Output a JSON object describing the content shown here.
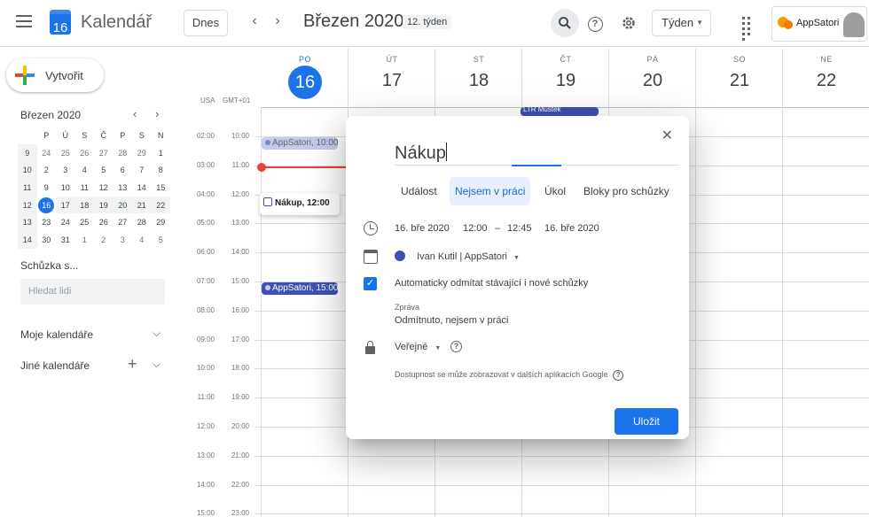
{
  "header": {
    "app_name": "Kalendář",
    "logo_day": "16",
    "today_label": "Dnes",
    "prev_icon": "chevron-left-icon",
    "next_icon": "chevron-right-icon",
    "current_month": "Březen 2020",
    "week_badge": "12. týden",
    "view_selector": "Týden",
    "brand_name": "AppSatori"
  },
  "sidebar": {
    "create_label": "Vytvořit",
    "mini_month": "Březen 2020",
    "weekday_headers": [
      "P",
      "Ú",
      "S",
      "Č",
      "P",
      "S",
      "N"
    ],
    "weeks": [
      {
        "wk": "9",
        "days": [
          "24",
          "25",
          "26",
          "27",
          "28",
          "29",
          "1"
        ]
      },
      {
        "wk": "10",
        "days": [
          "2",
          "3",
          "4",
          "5",
          "6",
          "7",
          "8"
        ]
      },
      {
        "wk": "11",
        "days": [
          "9",
          "10",
          "11",
          "12",
          "13",
          "14",
          "15"
        ]
      },
      {
        "wk": "12",
        "days": [
          "16",
          "17",
          "18",
          "19",
          "20",
          "21",
          "22"
        ]
      },
      {
        "wk": "13",
        "days": [
          "23",
          "24",
          "25",
          "26",
          "27",
          "28",
          "29"
        ]
      },
      {
        "wk": "14",
        "days": [
          "30",
          "31",
          "1",
          "2",
          "3",
          "4",
          "5"
        ]
      }
    ],
    "meeting_with": "Schůzka s...",
    "people_placeholder": "Hledat lidi",
    "my_calendars": "Moje kalendáře",
    "other_calendars": "Jiné kalendáře"
  },
  "week": {
    "tz_left": "USA",
    "tz_right": "GMT+01",
    "days": [
      {
        "name": "PO",
        "date": "16"
      },
      {
        "name": "ÚT",
        "date": "17"
      },
      {
        "name": "ST",
        "date": "18"
      },
      {
        "name": "ČT",
        "date": "19"
      },
      {
        "name": "PÁ",
        "date": "20"
      },
      {
        "name": "SO",
        "date": "21"
      },
      {
        "name": "NE",
        "date": "22"
      }
    ],
    "times_usa": [
      "02:00",
      "03:00",
      "04:00",
      "05:00",
      "06:00",
      "07:00",
      "08:00",
      "09:00",
      "10:00",
      "11:00",
      "12:00",
      "13:00",
      "14:00",
      "15:00"
    ],
    "times_local": [
      "10:00",
      "11:00",
      "12:00",
      "13:00",
      "14:00",
      "15:00",
      "16:00",
      "17:00",
      "18:00",
      "19:00",
      "20:00",
      "21:00",
      "22:00",
      "23:00"
    ],
    "events": [
      {
        "title": "AppSatori, 10:00"
      },
      {
        "title": "Nákup, 12:00"
      },
      {
        "title": "AppSatori, 15:00"
      },
      {
        "title": "LTR Mustek"
      }
    ]
  },
  "dialog": {
    "title_value": "Nákup",
    "tabs": [
      "Událost",
      "Nejsem v práci",
      "Úkol",
      "Bloky pro schůzky"
    ],
    "start_date": "16. bře 2020",
    "start_time": "12:00",
    "dash": "–",
    "end_time": "12:45",
    "end_date": "16. bře 2020",
    "calendar_owner": "Ivan Kutil | AppSatori",
    "auto_decline": "Automaticky odmítat stávající i nové schůzky",
    "message_label": "Zpráva",
    "message_value": "Odmítnuto, nejsem v práci",
    "visibility": "Veřejné",
    "availability_note": "Dostupnost se může zobrazovat v dalších aplikacích Google",
    "save_label": "Uložit"
  },
  "colors": {
    "accent": "#1a73e8",
    "event_indigo": "#3f51b5",
    "now_line": "#ea4335"
  }
}
